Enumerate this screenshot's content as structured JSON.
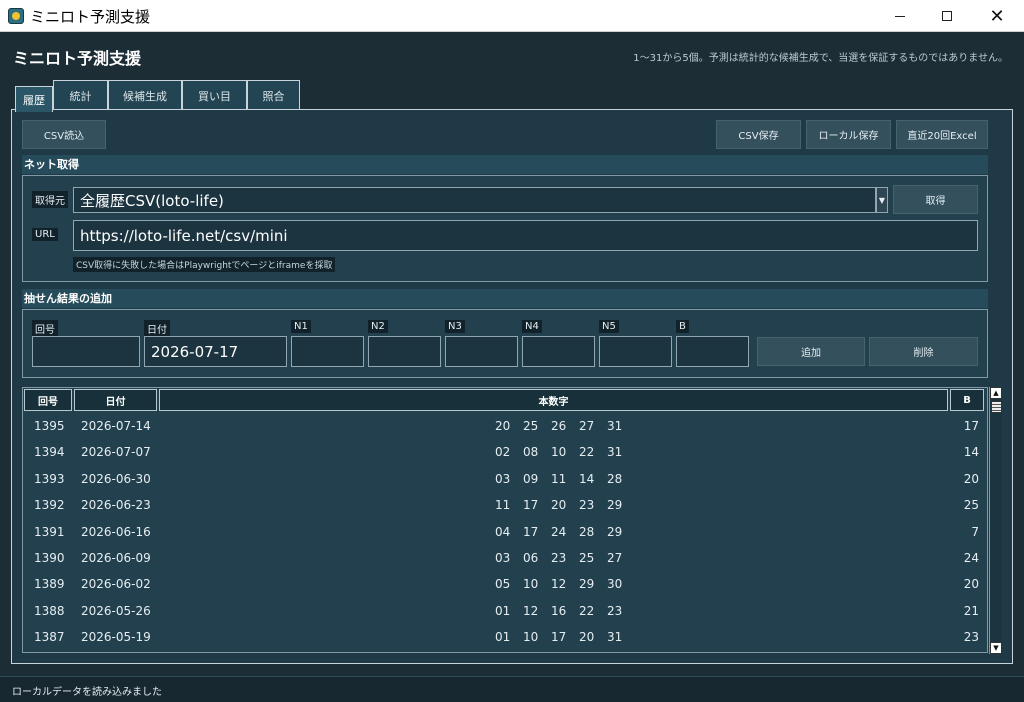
{
  "window": {
    "title": "ミニロト予測支援",
    "minimize": "",
    "maximize": "",
    "close": "✕"
  },
  "header": {
    "title": "ミニロト予測支援",
    "disclaimer": "1〜31から5個。予測は統計的な候補生成で、当選を保証するものではありません。"
  },
  "tabs": [
    {
      "label": "履歴",
      "active": true
    },
    {
      "label": "統計"
    },
    {
      "label": "候補生成"
    },
    {
      "label": "買い目"
    },
    {
      "label": "照合"
    }
  ],
  "toolbar": {
    "csv_load": "CSV読込",
    "csv_save": "CSV保存",
    "local_save": "ローカル保存",
    "excel_recent": "直近20回Excel"
  },
  "net_fetch": {
    "section_title": "ネット取得",
    "source_label": "取得元",
    "source_value": "全履歴CSV(loto-life)",
    "fetch_button": "取得",
    "url_label": "URL",
    "url_value": "https://loto-life.net/csv/mini",
    "hint": "CSV取得に失敗した場合はPlaywrightでページとiframeを採取"
  },
  "add_result": {
    "section_title": "抽せん結果の追加",
    "round_label": "回号",
    "round_value": "",
    "date_label": "日付",
    "date_value": "2026-07-17",
    "n1_label": "N1",
    "n2_label": "N2",
    "n3_label": "N3",
    "n4_label": "N4",
    "n5_label": "N5",
    "b_label": "B",
    "add_button": "追加",
    "delete_button": "削除"
  },
  "table": {
    "headers": {
      "round": "回号",
      "date": "日付",
      "numbers": "本数字",
      "bonus": "B"
    },
    "rows": [
      {
        "round": "1395",
        "date": "2026-07-14",
        "n": [
          "20",
          "25",
          "26",
          "27",
          "31"
        ],
        "b": "17"
      },
      {
        "round": "1394",
        "date": "2026-07-07",
        "n": [
          "02",
          "08",
          "10",
          "22",
          "31"
        ],
        "b": "14"
      },
      {
        "round": "1393",
        "date": "2026-06-30",
        "n": [
          "03",
          "09",
          "11",
          "14",
          "28"
        ],
        "b": "20"
      },
      {
        "round": "1392",
        "date": "2026-06-23",
        "n": [
          "11",
          "17",
          "20",
          "23",
          "29"
        ],
        "b": "25"
      },
      {
        "round": "1391",
        "date": "2026-06-16",
        "n": [
          "04",
          "17",
          "24",
          "28",
          "29"
        ],
        "b": "7"
      },
      {
        "round": "1390",
        "date": "2026-06-09",
        "n": [
          "03",
          "06",
          "23",
          "25",
          "27"
        ],
        "b": "24"
      },
      {
        "round": "1389",
        "date": "2026-06-02",
        "n": [
          "05",
          "10",
          "12",
          "29",
          "30"
        ],
        "b": "20"
      },
      {
        "round": "1388",
        "date": "2026-05-26",
        "n": [
          "01",
          "12",
          "16",
          "22",
          "23"
        ],
        "b": "21"
      },
      {
        "round": "1387",
        "date": "2026-05-19",
        "n": [
          "01",
          "10",
          "17",
          "20",
          "31"
        ],
        "b": "23"
      }
    ]
  },
  "status": {
    "message": "ローカルデータを読み込みました"
  }
}
